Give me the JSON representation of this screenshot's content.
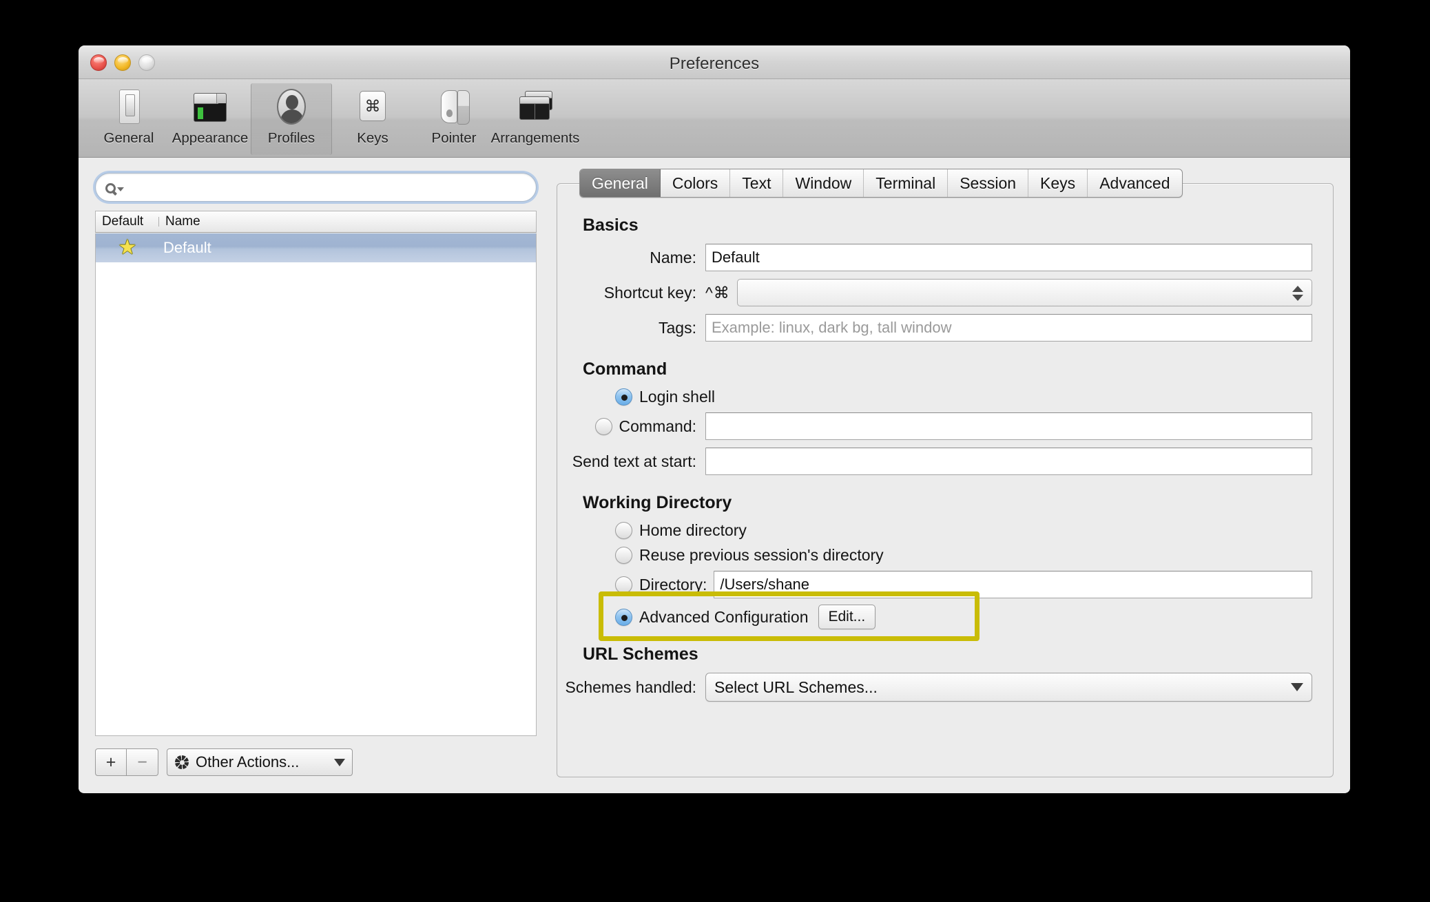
{
  "window": {
    "title": "Preferences",
    "controls": {
      "close": "close-button",
      "minimize": "minimize-button",
      "zoom": "zoom-button"
    }
  },
  "toolbar": {
    "items": [
      {
        "label": "General",
        "icon": "slider-switch-icon",
        "selected": false
      },
      {
        "label": "Appearance",
        "icon": "window-tabs-icon",
        "selected": false
      },
      {
        "label": "Profiles",
        "icon": "person-silhouette-icon",
        "selected": true
      },
      {
        "label": "Keys",
        "icon": "command-key-icon",
        "selected": false
      },
      {
        "label": "Pointer",
        "icon": "mouse-icon",
        "selected": false
      },
      {
        "label": "Arrangements",
        "icon": "stacked-windows-icon",
        "selected": false
      }
    ]
  },
  "sidebar": {
    "search": {
      "value": "",
      "placeholder": "",
      "icon": "search-magnifier-icon"
    },
    "columns": [
      "Default",
      "Name"
    ],
    "rows": [
      {
        "default_star": "★",
        "name": "Default",
        "selected": true
      }
    ],
    "footer": {
      "add_label": "+",
      "remove_label": "−",
      "other_actions_label": "Other Actions...",
      "gear_icon": "gear-icon",
      "caret_icon": "caret-down-icon"
    }
  },
  "tabs": [
    {
      "label": "General",
      "active": true
    },
    {
      "label": "Colors",
      "active": false
    },
    {
      "label": "Text",
      "active": false
    },
    {
      "label": "Window",
      "active": false
    },
    {
      "label": "Terminal",
      "active": false
    },
    {
      "label": "Session",
      "active": false
    },
    {
      "label": "Keys",
      "active": false
    },
    {
      "label": "Advanced",
      "active": false
    }
  ],
  "general": {
    "basics": {
      "title": "Basics",
      "name_label": "Name:",
      "name_value": "Default",
      "shortcut_label": "Shortcut key:",
      "shortcut_modifiers": "^⌘",
      "shortcut_value": "",
      "tags_label": "Tags:",
      "tags_value": "",
      "tags_placeholder": "Example: linux, dark bg, tall window"
    },
    "command": {
      "title": "Command",
      "login_shell_label": "Login shell",
      "login_shell_selected": true,
      "command_label": "Command:",
      "command_selected": false,
      "command_value": "",
      "send_text_label": "Send text at start:",
      "send_text_value": ""
    },
    "working_directory": {
      "title": "Working Directory",
      "home_label": "Home directory",
      "home_selected": false,
      "reuse_label": "Reuse previous session's directory",
      "reuse_selected": false,
      "directory_label": "Directory:",
      "directory_selected": false,
      "directory_value": "/Users/shane",
      "advanced_label": "Advanced Configuration",
      "advanced_selected": true,
      "edit_button_label": "Edit..."
    },
    "url_schemes": {
      "title": "URL Schemes",
      "schemes_label": "Schemes handled:",
      "schemes_value": "Select URL Schemes...",
      "caret_icon": "caret-down-icon"
    }
  },
  "annotation": {
    "highlight_color": "#c9bc06",
    "target": "advanced-configuration-row"
  }
}
